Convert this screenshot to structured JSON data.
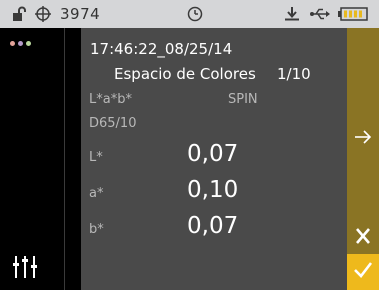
{
  "status_bar": {
    "serial": "3974",
    "icons": [
      "unlock-icon",
      "target-icon",
      "clock-icon",
      "download-icon",
      "usb-icon",
      "battery-icon"
    ]
  },
  "sidebar": {
    "icons": [
      "color-dots-icon",
      "sliders-icon"
    ],
    "dot_colors": [
      "#e3a39a",
      "#b49ac7",
      "#b9d79e"
    ]
  },
  "main": {
    "timestamp": "17:46:22_08/25/14",
    "color_space_label": "Espacio de Colores",
    "color_space_count": "1/10",
    "mode": "L*a*b*",
    "spin": "SPIN",
    "illuminant": "D65/10",
    "measurements": [
      {
        "label": "L*",
        "value": "0,07"
      },
      {
        "label": "a*",
        "value": "0,10"
      },
      {
        "label": "b*",
        "value": "0,07"
      }
    ]
  },
  "actions": {
    "next_icon": "arrow-right-icon",
    "cancel_icon": "close-icon",
    "confirm_icon": "check-icon"
  },
  "colors": {
    "status_bar_bg": "#d5d6d8",
    "main_bg": "#4a4a4a",
    "action_bg": "#8a7424",
    "confirm_bg": "#eeb91c"
  }
}
